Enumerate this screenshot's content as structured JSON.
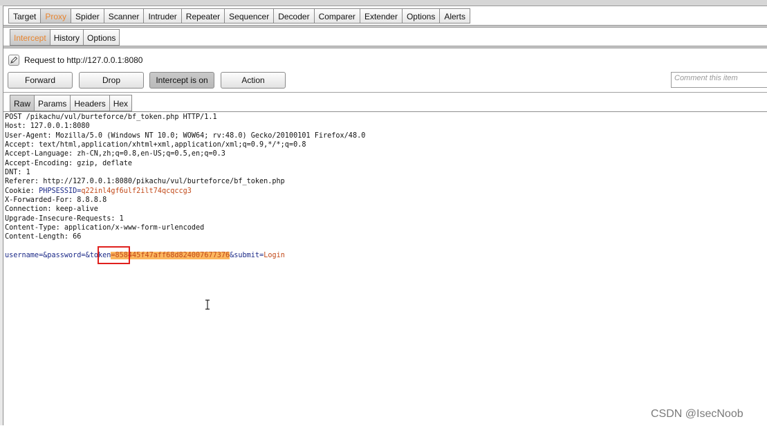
{
  "main_tabs": [
    "Target",
    "Proxy",
    "Spider",
    "Scanner",
    "Intruder",
    "Repeater",
    "Sequencer",
    "Decoder",
    "Comparer",
    "Extender",
    "Options",
    "Alerts"
  ],
  "active_main_tab": "Proxy",
  "sub_tabs": [
    "Intercept",
    "History",
    "Options"
  ],
  "active_sub_tab": "Intercept",
  "request": {
    "label": "Request to http://127.0.0.1:8080",
    "icon": "pencil-icon"
  },
  "buttons": {
    "forward": "Forward",
    "drop": "Drop",
    "intercept": "Intercept is on",
    "action": "Action"
  },
  "comment": {
    "placeholder": "Comment this item"
  },
  "view_tabs": [
    "Raw",
    "Params",
    "Headers",
    "Hex"
  ],
  "active_view_tab": "Raw",
  "http": {
    "request_line": "POST /pikachu/vul/burteforce/bf_token.php HTTP/1.1",
    "headers": [
      "Host: 127.0.0.1:8080",
      "User-Agent: Mozilla/5.0 (Windows NT 10.0; WOW64; rv:48.0) Gecko/20100101 Firefox/48.0",
      "Accept: text/html,application/xhtml+xml,application/xml;q=0.9,*/*;q=0.8",
      "Accept-Language: zh-CN,zh;q=0.8,en-US;q=0.5,en;q=0.3",
      "Accept-Encoding: gzip, deflate",
      "DNT: 1",
      "Referer: http://127.0.0.1:8080/pikachu/vul/burteforce/bf_token.php"
    ],
    "cookie": {
      "label": "Cookie: ",
      "name": "PHPSESSID",
      "eq": "=",
      "value": "q22inl4gf6ulf2ilt74qcqccg3"
    },
    "headers_after": [
      "X-Forwarded-For: 8.8.8.8",
      "Connection: keep-alive",
      "Upgrade-Insecure-Requests: 1",
      "Content-Type: application/x-www-form-urlencoded",
      "Content-Length: 66"
    ],
    "body": {
      "username_name": "username",
      "eq1": "=",
      "password_name": "&password",
      "eq2": "=",
      "token_name": "&token",
      "eq3": "=",
      "token_value": "858445f47aff68d824007677376",
      "submit_name": "&submit",
      "eq4": "=",
      "submit_value": "Login"
    }
  },
  "colors": {
    "active_tab_text": "#e8852f",
    "token_highlight": "#fbb65f",
    "annotation_box": "#e0201d",
    "param_name": "#1c2a88",
    "param_value": "#c24a1a"
  },
  "watermark": "CSDN @IsecNoob"
}
